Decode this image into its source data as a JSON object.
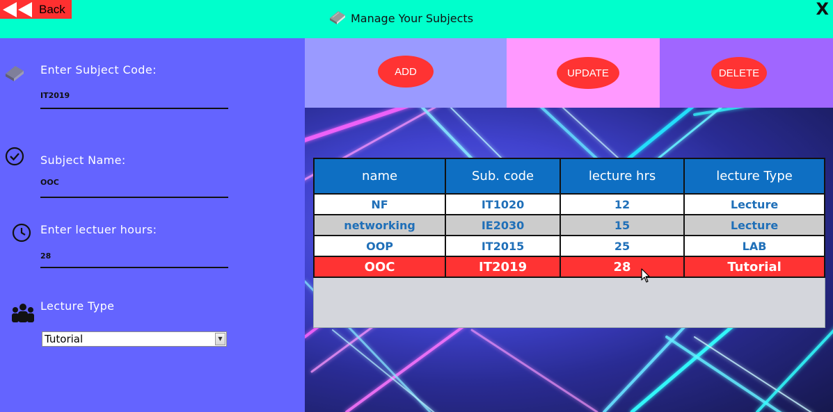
{
  "header": {
    "back_label": "Back",
    "title": "Manage Your Subjects",
    "close_label": "X"
  },
  "form": {
    "subject_code_label": "Enter Subject Code:",
    "subject_code_value": "IT2019",
    "subject_name_label": "Subject Name:",
    "subject_name_value": "OOC",
    "lecture_hours_label": "Enter lectuer hours:",
    "lecture_hours_value": "28",
    "lecture_type_label": "Lecture Type",
    "lecture_type_value": "Tutorial"
  },
  "actions": {
    "add": "ADD",
    "update": "UPDATE",
    "delete": "DELETE"
  },
  "table": {
    "columns": [
      "name",
      "Sub. code",
      "lecture hrs",
      "lecture Type"
    ],
    "rows": [
      [
        "NF",
        "IT1020",
        "12",
        "Lecture"
      ],
      [
        "networking",
        "IE2030",
        "15",
        "Lecture"
      ],
      [
        "OOP",
        "IT2015",
        "25",
        "LAB"
      ],
      [
        "OOC",
        "IT2019",
        "28",
        "Tutorial"
      ]
    ],
    "selected_row": 3
  },
  "colors": {
    "header_bg": "#00ffcc",
    "panel_bg": "#6464ff",
    "accent_red": "#ff3333",
    "table_header": "#0e6fc3"
  },
  "icons": [
    "rewind-icon",
    "book-icon",
    "close-icon",
    "check-circle-icon",
    "clock-icon",
    "group-icon",
    "mouse-cursor-icon"
  ]
}
